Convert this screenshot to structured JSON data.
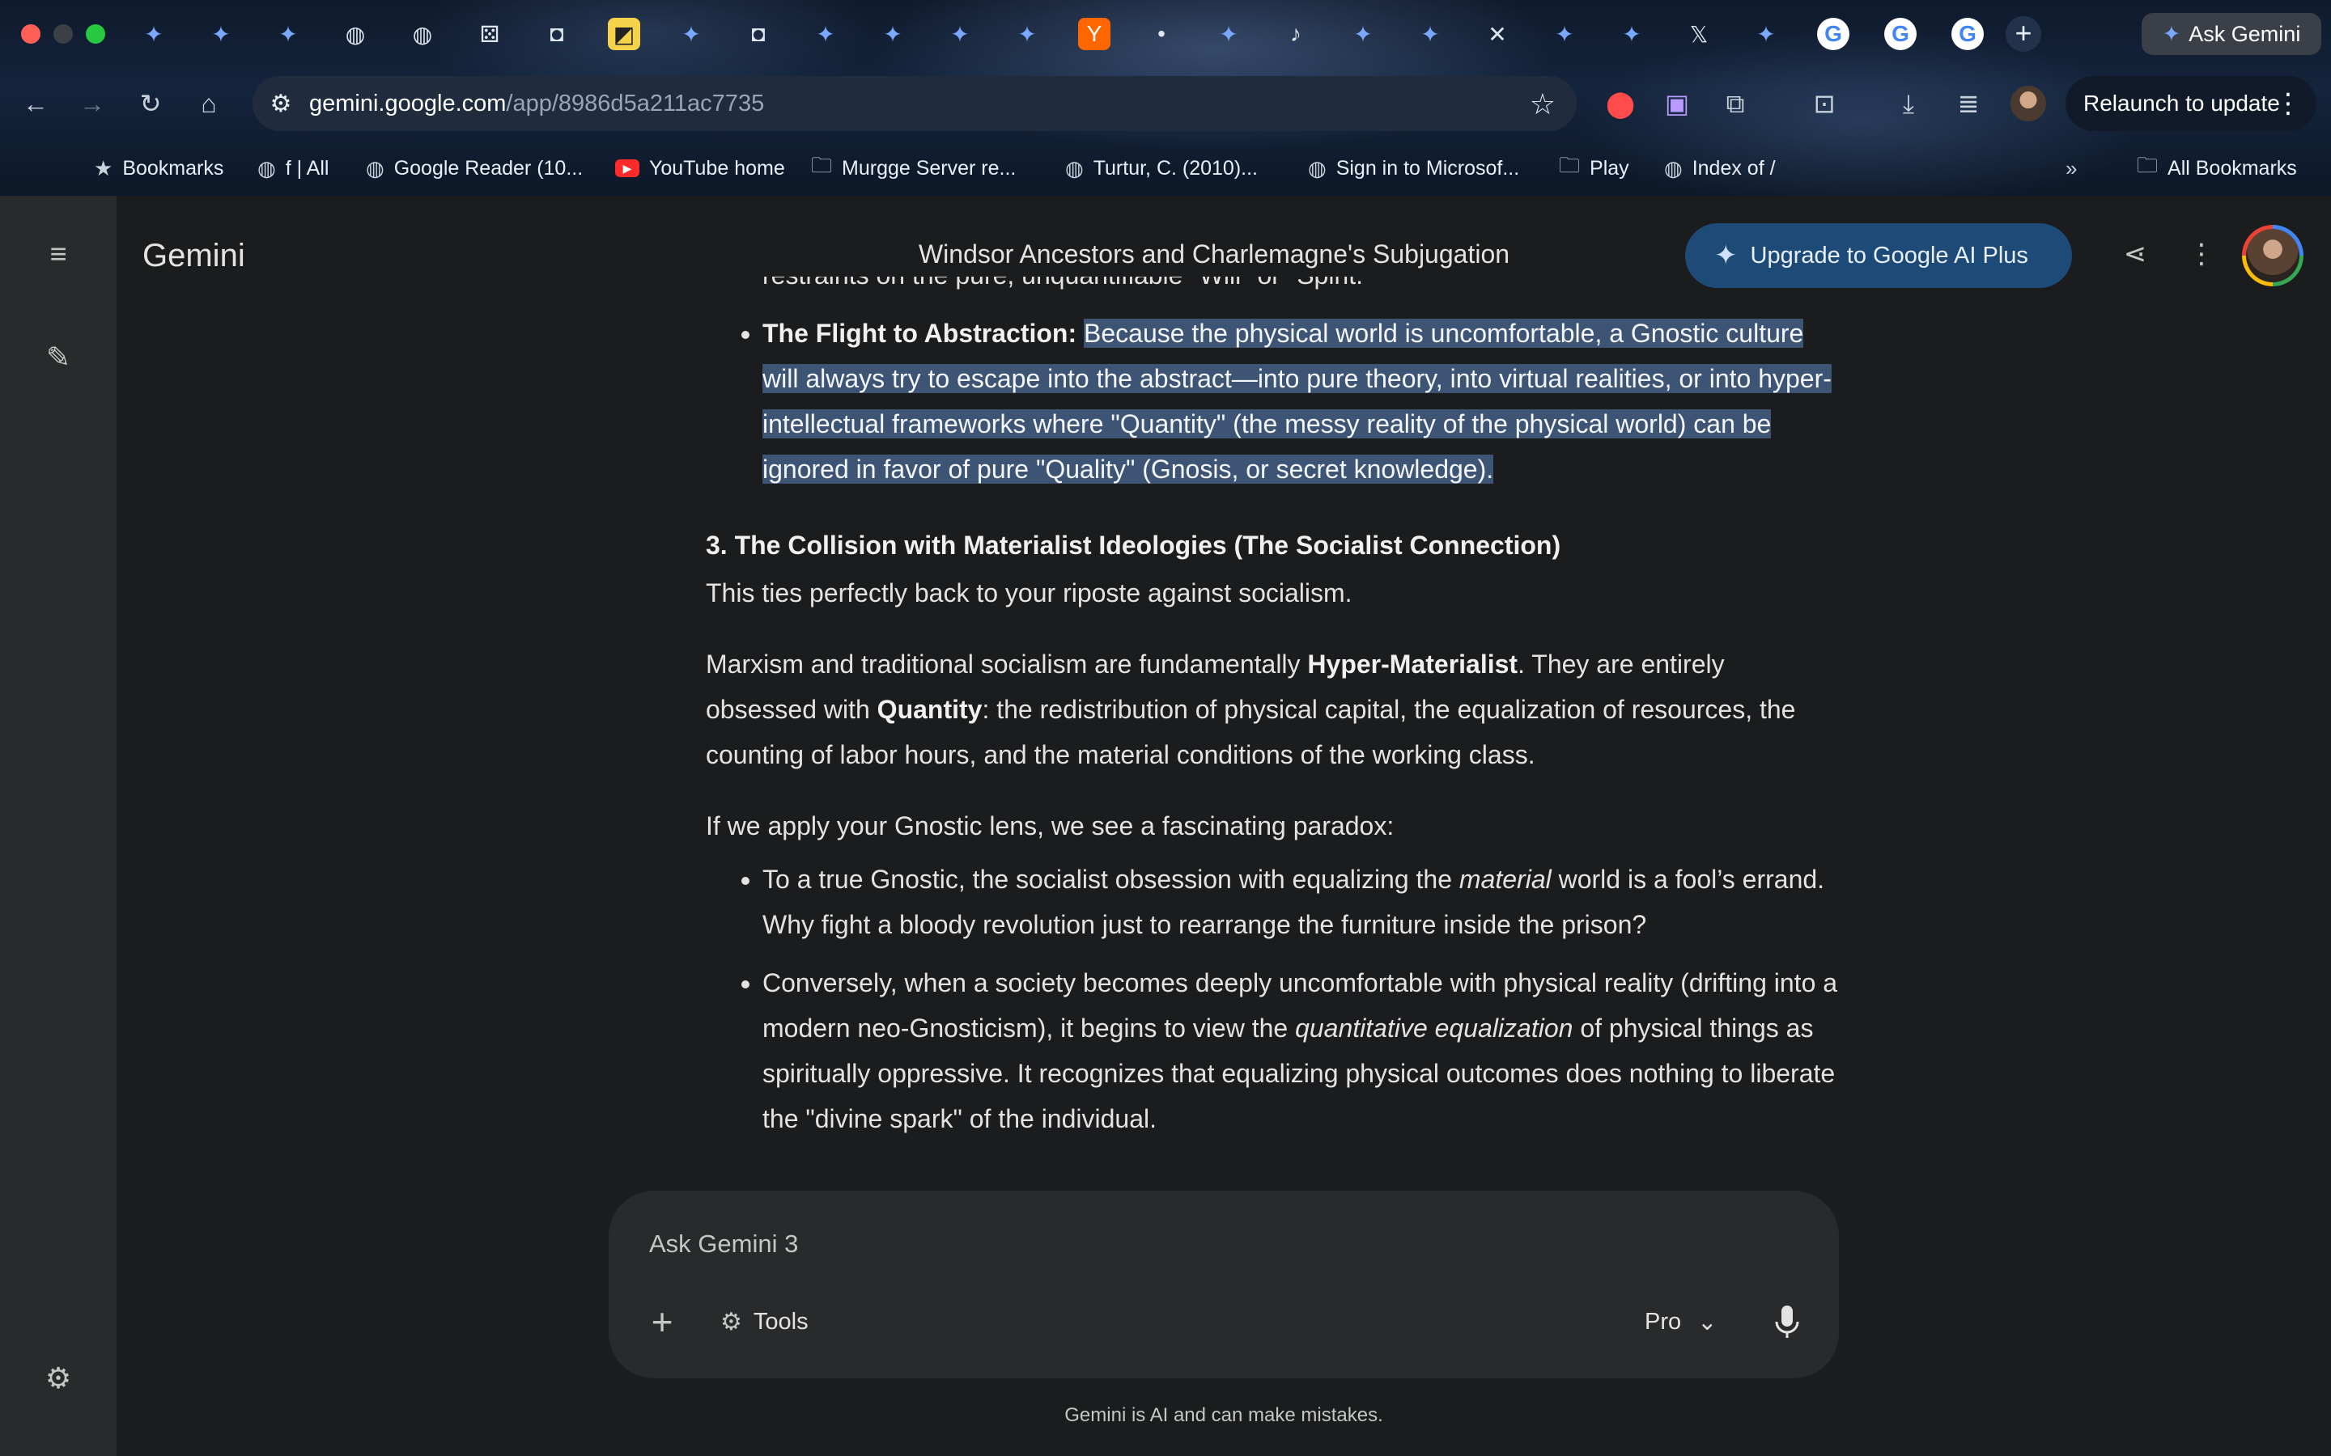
{
  "browser": {
    "tab_icons": [
      "gemini-spark",
      "gemini-spark",
      "gemini-spark",
      "globe",
      "globe",
      "dice",
      "reader",
      "yellow-app",
      "gemini-spark",
      "reader",
      "gemini-spark",
      "gemini-spark",
      "gemini-spark",
      "gemini-spark",
      "hacker-news",
      "dot",
      "gemini-spark",
      "audio",
      "gemini-spark",
      "gemini-spark",
      "close",
      "gemini-spark",
      "gemini-spark",
      "x-logo",
      "gemini-spark",
      "google",
      "google",
      "google"
    ],
    "ask_gemini_label": "Ask Gemini",
    "url_host": "gemini.google.com",
    "url_path": "/app/8986d5a211ac7735",
    "relaunch_label": "Relaunch to update",
    "bookmarks": [
      {
        "label": "Bookmarks",
        "icon": "star"
      },
      {
        "label": "f | All",
        "icon": "globe"
      },
      {
        "label": "Google Reader (10...",
        "icon": "globe"
      },
      {
        "label": "YouTube home",
        "icon": "youtube"
      },
      {
        "label": "Murgge Server re...",
        "icon": "folder"
      },
      {
        "label": "Turtur, C. (2010)...",
        "icon": "globe"
      },
      {
        "label": "Sign in to Microsof...",
        "icon": "globe"
      },
      {
        "label": "Play",
        "icon": "folder"
      },
      {
        "label": "Index of /",
        "icon": "globe"
      }
    ],
    "all_bookmarks_label": "All Bookmarks"
  },
  "app": {
    "brand": "Gemini",
    "conversation_title": "Windsor Ancestors and Charlemagne's Subjugation",
    "upgrade_label": "Upgrade to Google AI Plus"
  },
  "conversation": {
    "top_cut_text": "restraints on the pure, unquantifiable \"Will\" or \"Spirit.\"",
    "bullet_flight_title": "The Flight to Abstraction:",
    "bullet_flight_text": "Because the physical world is uncomfortable, a Gnostic culture will always try to escape into the abstract—into pure theory, into virtual realities, or into hyper-intellectual frameworks where \"Quantity\" (the messy reality of the physical world) can be ignored in favor of pure \"Quality\" (Gnosis, or secret knowledge).",
    "section3_heading": "3. The Collision with Materialist Ideologies (The Socialist Connection)",
    "section3_intro": "This ties perfectly back to your riposte against socialism.",
    "p2_a": "Marxism and traditional socialism are fundamentally ",
    "p2_b": "Hyper-Materialist",
    "p2_c": ". They are entirely obsessed with ",
    "p2_d": "Quantity",
    "p2_e": ": the redistribution of physical capital, the equalization of resources, the counting of labor hours, and the material conditions of the working class.",
    "p3": "If we apply your Gnostic lens, we see a fascinating paradox:",
    "b1_a": "To a true Gnostic, the socialist obsession with equalizing the ",
    "b1_b": "material",
    "b1_c": " world is a fool’s errand. Why fight a bloody revolution just to rearrange the furniture inside the prison?",
    "b2_a": "Conversely, when a society becomes deeply uncomfortable with physical reality (drifting into a modern neo-Gnosticism), it begins to view the ",
    "b2_b": "quantitative equalization",
    "b2_c": " of physical things as spiritually oppressive. It recognizes that equalizing physical outcomes does nothing to liberate the \"divine spark\" of the individual."
  },
  "composer": {
    "placeholder": "Ask Gemini 3",
    "tools_label": "Tools",
    "model_label": "Pro"
  },
  "disclaimer": "Gemini is AI and can make mistakes."
}
